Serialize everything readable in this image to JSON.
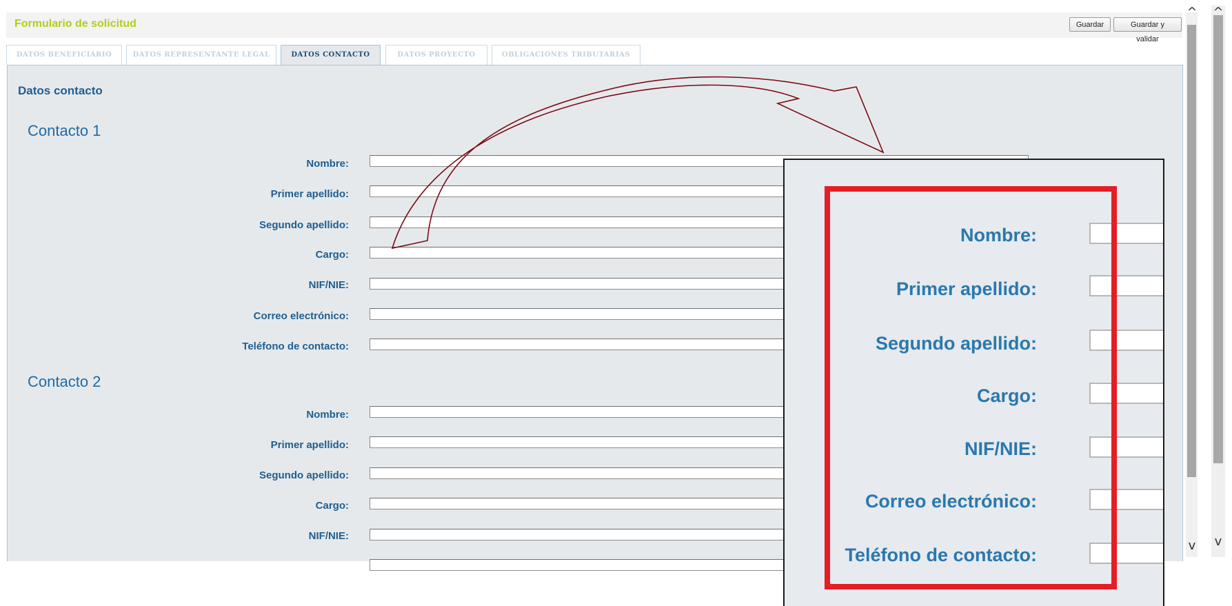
{
  "header": {
    "title": "Formulario de solicitud",
    "save_label": "Guardar",
    "save_validate_label": "Guardar y validar"
  },
  "tabs": [
    {
      "label": "DATOS BENEFICIARIO",
      "active": false
    },
    {
      "label": "DATOS REPRESENTANTE LEGAL",
      "active": false
    },
    {
      "label": "DATOS CONTACTO",
      "active": true
    },
    {
      "label": "DATOS PROYECTO",
      "active": false
    },
    {
      "label": "OBLIGACIONES TRIBUTARIAS",
      "active": false
    }
  ],
  "main": {
    "section_title": "Datos contacto",
    "contact1": {
      "title": "Contacto 1",
      "fields": [
        {
          "label": "Nombre:",
          "value": ""
        },
        {
          "label": "Primer apellido:",
          "value": ""
        },
        {
          "label": "Segundo apellido:",
          "value": ""
        },
        {
          "label": "Cargo:",
          "value": ""
        },
        {
          "label": "NIF/NIE:",
          "value": ""
        },
        {
          "label": "Correo electrónico:",
          "value": ""
        },
        {
          "label": "Teléfono de contacto:",
          "value": ""
        }
      ]
    },
    "contact2": {
      "title": "Contacto 2",
      "fields": [
        {
          "label": "Nombre:",
          "value": ""
        },
        {
          "label": "Primer apellido:",
          "value": ""
        },
        {
          "label": "Segundo apellido:",
          "value": ""
        },
        {
          "label": "Cargo:",
          "value": ""
        },
        {
          "label": "NIF/NIE:",
          "value": ""
        }
      ]
    }
  },
  "zoom": {
    "labels": [
      "Nombre:",
      "Primer apellido:",
      "Segundo apellido:",
      "Cargo:",
      "NIF/NIE:",
      "Correo electrónico:",
      "Teléfono de contacto:"
    ]
  },
  "scrollbar": {
    "up_icon": "chevron-up-icon",
    "down_icon": "chevron-down-icon"
  },
  "colors": {
    "header_title": "#b5cc18",
    "label": "#1e5e90",
    "group_title": "#1f6aa5",
    "panel_bg": "#e6e9ec",
    "highlight": "#e31e26",
    "arrow": "#7a0a14"
  }
}
